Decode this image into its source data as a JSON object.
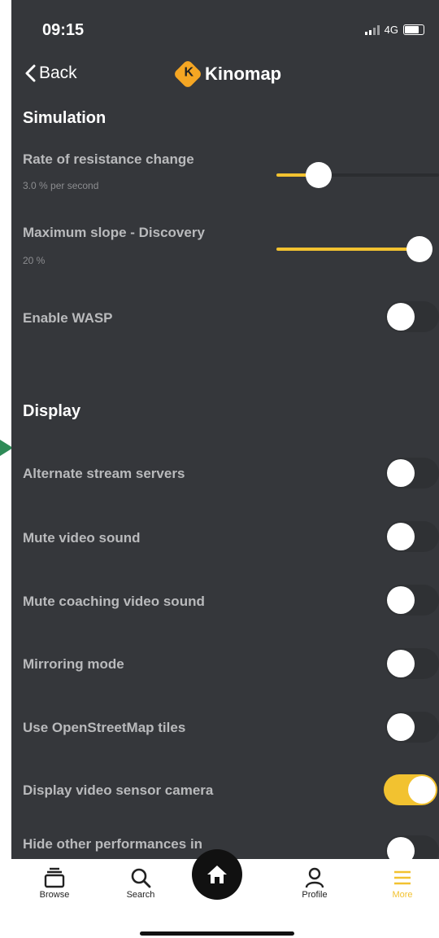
{
  "status": {
    "time": "09:15",
    "network": "4G"
  },
  "nav": {
    "back_label": "Back",
    "logo_text": "Kinomap"
  },
  "sections": {
    "simulation": "Simulation",
    "display": "Display"
  },
  "settings": {
    "rate": {
      "title": "Rate of resistance change",
      "value": "3.0 % per second",
      "level": 0.2
    },
    "slope": {
      "title": "Maximum slope - Discovery",
      "value": "20 %",
      "level": 1.0
    },
    "wasp": {
      "title": "Enable WASP",
      "on": false
    },
    "alt_stream": {
      "title": "Alternate stream servers",
      "on": false
    },
    "mute_video": {
      "title": "Mute video sound",
      "on": false
    },
    "mute_coaching": {
      "title": "Mute coaching video sound",
      "on": false
    },
    "mirroring": {
      "title": "Mirroring mode",
      "on": false
    },
    "osm": {
      "title": "Use OpenStreetMap tiles",
      "on": false
    },
    "sensor_cam": {
      "title": "Display video sensor camera",
      "on": true
    },
    "hide_perf": {
      "title": "Hide other performances in",
      "on": false
    }
  },
  "tabs": {
    "browse": "Browse",
    "search": "Search",
    "profile": "Profile",
    "more": "More"
  },
  "colors": {
    "accent": "#f2c230",
    "background": "#35373b"
  }
}
